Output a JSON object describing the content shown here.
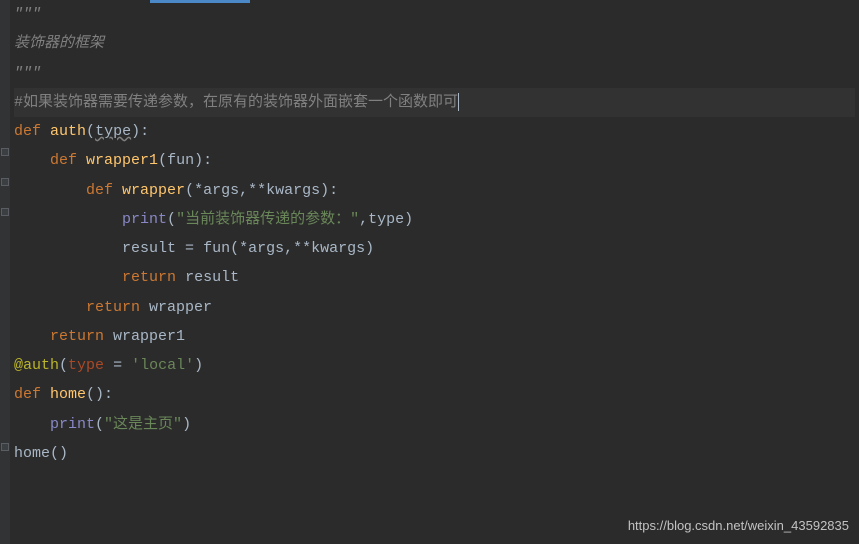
{
  "code": {
    "docstring_open": "\"\"\"",
    "docstring_body": "装饰器的框架",
    "docstring_close": "\"\"\"",
    "comment1": "#如果装饰器需要传递参数，在原有的装饰器外面嵌套一个函数即可",
    "kw_def": "def",
    "fn_auth": "auth",
    "param_type": "type",
    "fn_wrapper1": "wrapper1",
    "param_fun": "fun",
    "fn_wrapper": "wrapper",
    "param_star": "*args",
    "param_dstar": "**kwargs",
    "builtin_print": "print",
    "str_print1": "\"当前装饰器传递的参数：\"",
    "arg_type": "type",
    "var_result": "result",
    "eq": " = ",
    "call_fun": "fun",
    "kw_return": "return",
    "ret_result": "result",
    "ret_wrapper": "wrapper",
    "ret_wrapper1": "wrapper1",
    "deco_at": "@",
    "deco_auth": "auth",
    "deco_kw": "type",
    "deco_eq": " = ",
    "deco_val": "'local'",
    "fn_home": "home",
    "str_home": "\"这是主页\"",
    "call_home": "home"
  },
  "watermark": "https://blog.csdn.net/weixin_43592835"
}
